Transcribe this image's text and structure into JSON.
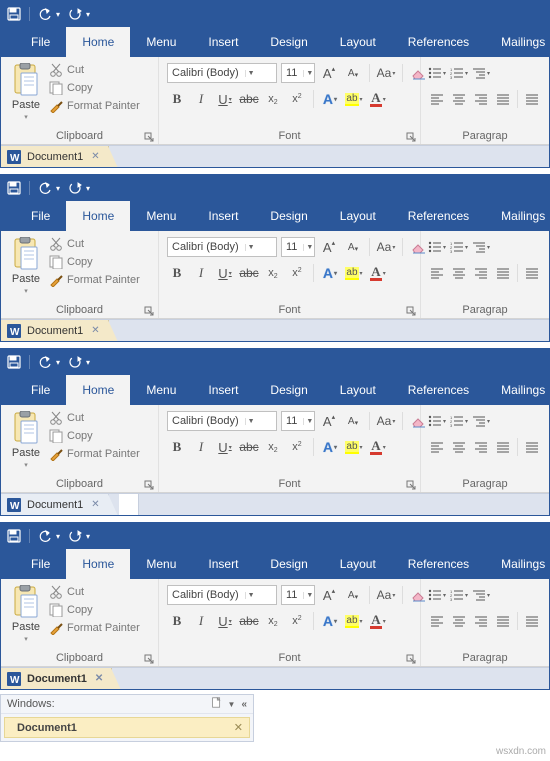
{
  "qat": {
    "save": "save",
    "undo": "undo",
    "redo": "redo"
  },
  "tabs": {
    "file": "File",
    "home": "Home",
    "menu": "Menu",
    "insert": "Insert",
    "design": "Design",
    "layout": "Layout",
    "references": "References",
    "mailings": "Mailings"
  },
  "clipboard": {
    "paste": "Paste",
    "cut": "Cut",
    "copy": "Copy",
    "format_painter": "Format Painter",
    "label": "Clipboard"
  },
  "font": {
    "name": "Calibri (Body)",
    "size": "11",
    "grow": "A",
    "shrink": "A",
    "case": "Aa",
    "bold": "B",
    "italic": "I",
    "underline": "U",
    "strike": "abc",
    "sub": "x",
    "sub2": "2",
    "sup": "x",
    "sup2": "2",
    "textfx": "A",
    "highlight": "ab",
    "color": "A",
    "label": "Font"
  },
  "paragraph": {
    "label": "Paragrap"
  },
  "doctab": {
    "name": "Document1"
  },
  "winpanel": {
    "title": "Windows:",
    "item": "Document1"
  },
  "watermark": "wsxdn.com"
}
